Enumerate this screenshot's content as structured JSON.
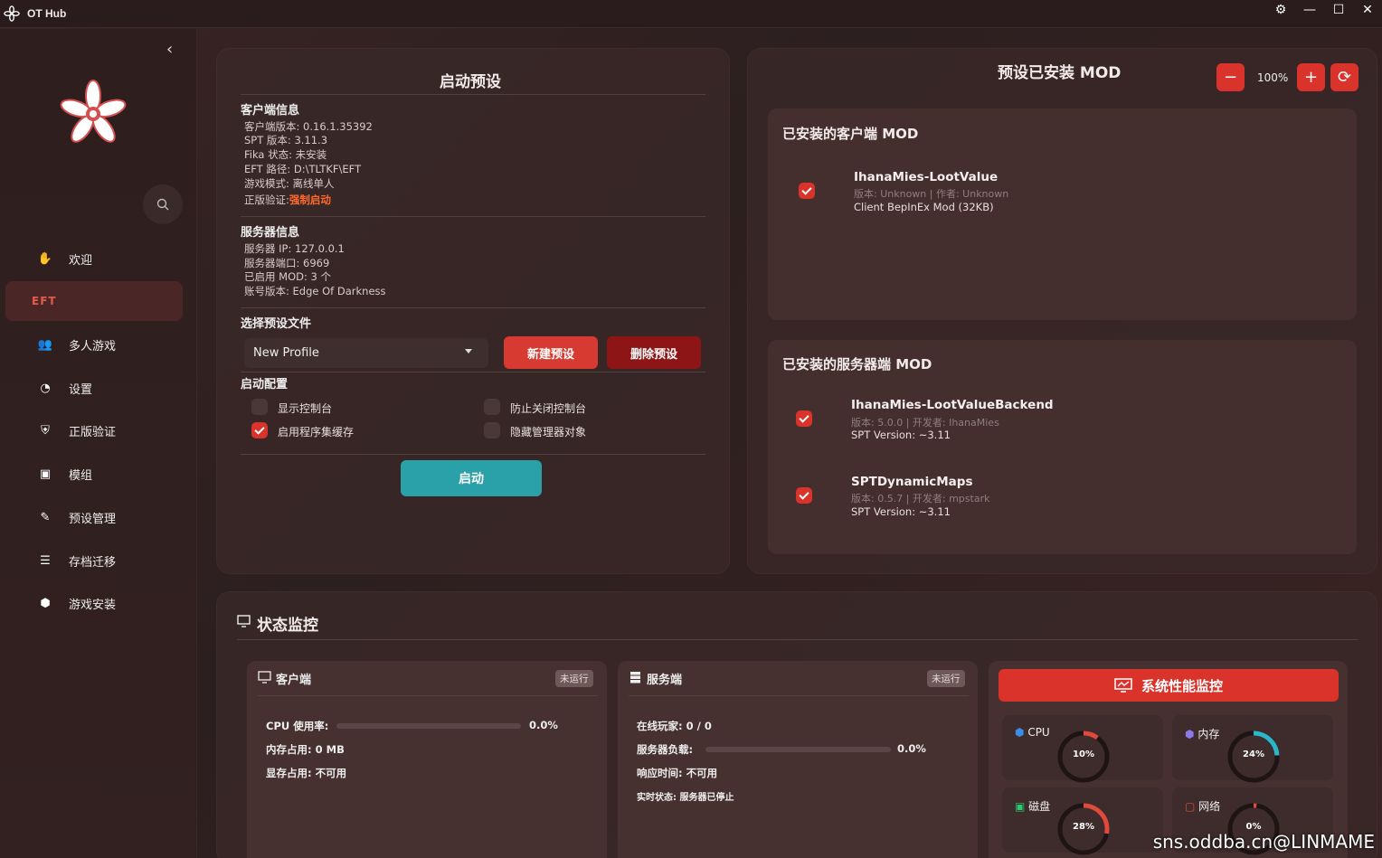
{
  "window": {
    "title": "OT Hub",
    "controls": [
      "gear",
      "minimize",
      "maximize",
      "close"
    ]
  },
  "sidebar": {
    "items": [
      {
        "label": "欢迎",
        "icon": "hand-icon"
      },
      {
        "label": "EFT",
        "icon": ""
      },
      {
        "label": "多人游戏",
        "icon": "users-icon"
      },
      {
        "label": "设置",
        "icon": "palette-icon"
      },
      {
        "label": "正版验证",
        "icon": "shield-icon"
      },
      {
        "label": "模组",
        "icon": "box-icon"
      },
      {
        "label": "预设管理",
        "icon": "brush-icon"
      },
      {
        "label": "存档迁移",
        "icon": "database-icon"
      },
      {
        "label": "游戏安装",
        "icon": "cube-icon"
      }
    ],
    "active": "EFT"
  },
  "launch": {
    "title": "启动预设",
    "client_title": "客户端信息",
    "client_lines": [
      "客户端版本: 0.16.1.35392",
      "SPT 版本: 3.11.3",
      "Fika 状态: 未安装",
      "EFT 路径: D:\\TLTKF\\EFT",
      "游戏模式: 离线单人"
    ],
    "auth_prefix": "正版验证:",
    "auth_value": "强制启动",
    "server_title": "服务器信息",
    "server_lines": [
      "服务器 IP: 127.0.0.1",
      "服务器端口: 6969",
      "已启用 MOD: 3 个",
      "账号版本: Edge Of Darkness"
    ],
    "profile_title": "选择预设文件",
    "profile_selected": "New Profile",
    "new_btn": "新建预设",
    "delete_btn": "删除预设",
    "config_title": "启动配置",
    "options": [
      {
        "label": "显示控制台",
        "checked": false
      },
      {
        "label": "防止关闭控制台",
        "checked": false
      },
      {
        "label": "启用程序集缓存",
        "checked": true
      },
      {
        "label": "隐藏管理器对象",
        "checked": false
      }
    ],
    "launch_btn": "启动"
  },
  "mods": {
    "title": "预设已安装 MOD",
    "zoom": "100%",
    "client_title": "已安装的客户端 MOD",
    "client_mods": [
      {
        "name": "IhanaMies-LootValue",
        "meta": "版本: Unknown | 作者: Unknown",
        "desc": "Client BepInEx Mod (32KB)",
        "checked": true
      }
    ],
    "server_title": "已安装的服务器端 MOD",
    "server_mods": [
      {
        "name": "IhanaMies-LootValueBackend",
        "meta": "版本: 5.0.0 | 开发者: IhanaMies",
        "desc": "SPT Version: ~3.11",
        "checked": true
      },
      {
        "name": "SPTDynamicMaps",
        "meta": "版本: 0.5.7 | 开发者: mpstark",
        "desc": "SPT Version: ~3.11",
        "checked": true
      }
    ]
  },
  "status": {
    "title": "状态监控",
    "client": {
      "title": "客户端",
      "badge": "未运行",
      "cpu_label": "CPU 使用率:",
      "cpu_value": "0.0%",
      "cpu_fraction": 0,
      "mem_label": "内存占用:",
      "mem_value": "0 MB",
      "vram_label": "显存占用:",
      "vram_value": "不可用"
    },
    "server": {
      "title": "服务端",
      "badge": "未运行",
      "players_label": "在线玩家:",
      "players_value": "0 / 0",
      "load_label": "服务器负载:",
      "load_value": "0.0%",
      "load_fraction": 0,
      "resp_label": "响应时间:",
      "resp_value": "不可用",
      "live_label": "实时状态:",
      "live_value": "服务器已停止"
    },
    "perf": {
      "title": "系统性能监控",
      "gauges": [
        {
          "label": "CPU",
          "value": "10%",
          "fraction": 0.1,
          "color": "#e04a3a",
          "icon": "cpu-icon",
          "iconColor": "#3a8ee8"
        },
        {
          "label": "内存",
          "value": "24%",
          "fraction": 0.24,
          "color": "#2ab8c8",
          "icon": "memory-icon",
          "iconColor": "#8a7ae8"
        },
        {
          "label": "磁盘",
          "value": "28%",
          "fraction": 0.28,
          "color": "#e04a3a",
          "icon": "disk-icon",
          "iconColor": "#2ac870"
        },
        {
          "label": "网络",
          "value": "0%",
          "fraction": 0.0,
          "color": "#e04a3a",
          "icon": "network-icon",
          "iconColor": "#e04a3a"
        }
      ]
    }
  },
  "watermark": "sns.oddba.cn@LINMAME"
}
